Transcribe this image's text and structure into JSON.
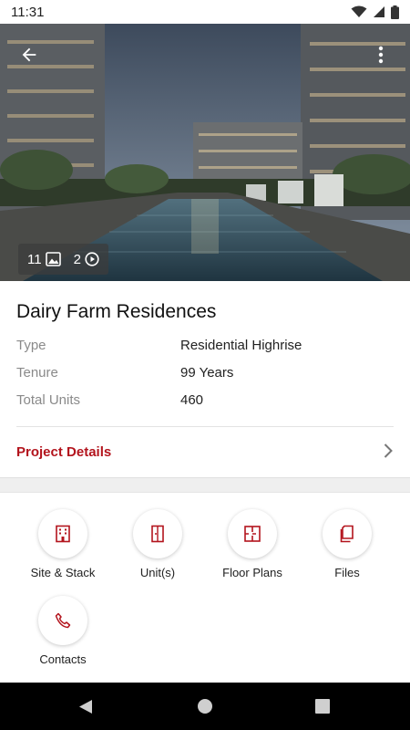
{
  "status_bar": {
    "time": "11:31"
  },
  "hero": {
    "back_icon": "arrow-left-icon",
    "more_icon": "more-vert-icon",
    "photos_count": "11",
    "videos_count": "2"
  },
  "project": {
    "title": "Dairy Farm Residences",
    "details": [
      {
        "key": "Type",
        "value": "Residential Highrise"
      },
      {
        "key": "Tenure",
        "value": "99 Years"
      },
      {
        "key": "Total Units",
        "value": "460"
      }
    ],
    "details_link": "Project Details"
  },
  "actions": [
    {
      "label": "Site & Stack",
      "icon": "building-icon"
    },
    {
      "label": "Unit(s)",
      "icon": "door-icon"
    },
    {
      "label": "Floor Plans",
      "icon": "floor-plan-icon"
    },
    {
      "label": "Files",
      "icon": "files-icon"
    },
    {
      "label": "Contacts",
      "icon": "phone-icon"
    }
  ],
  "colors": {
    "accent": "#b3141d",
    "nav_bar": "#000000"
  }
}
